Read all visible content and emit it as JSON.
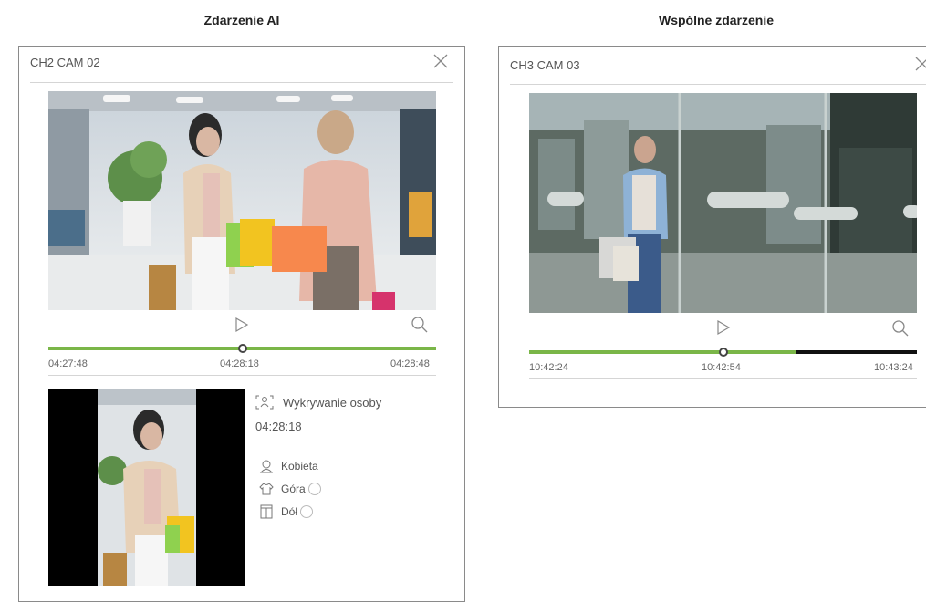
{
  "captions": {
    "left": "Zdarzenie AI",
    "right": "Wspólne zdarzenie"
  },
  "left_panel": {
    "title": "CH2 CAM 02",
    "times": [
      "04:27:48",
      "04:28:18",
      "04:28:48"
    ],
    "progress": 1.0,
    "detection": {
      "type_label": "Wykrywanie osoby",
      "timestamp": "04:28:18",
      "attributes": [
        {
          "icon": "person-bust-icon",
          "label": "Kobieta",
          "has_color": false
        },
        {
          "icon": "upper-body-clothing-icon",
          "label": "Góra",
          "has_color": true
        },
        {
          "icon": "lower-body-clothing-icon",
          "label": "Dół",
          "has_color": true
        }
      ]
    }
  },
  "right_panel": {
    "title": "CH3 CAM 03",
    "times": [
      "10:42:24",
      "10:42:54",
      "10:43:24"
    ],
    "recorded_fraction": 0.69
  },
  "colors": {
    "timeline_green": "#7ab648",
    "timeline_black": "#111111"
  }
}
